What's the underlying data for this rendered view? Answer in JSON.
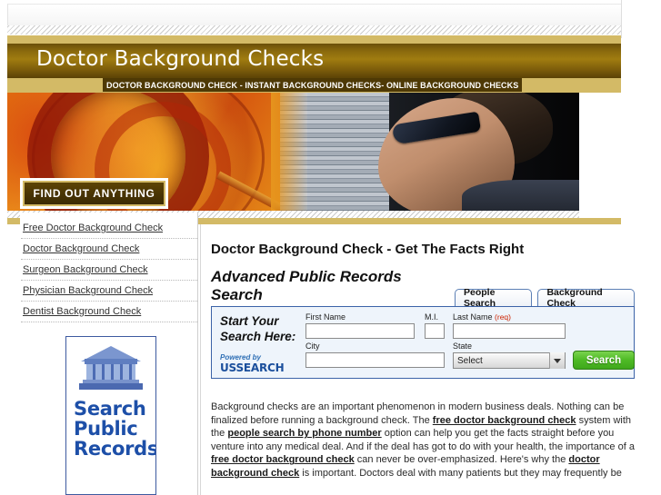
{
  "header": {
    "site_title": "Doctor Background Checks",
    "subtitle": "DOCTOR BACKGROUND CHECK - INSTANT BACKGROUND CHECKS- ONLINE BACKGROUND CHECKS",
    "badge_label": "FIND OUT ANYTHING",
    "gold": "#d3ba66",
    "brown": "#4e3905"
  },
  "sidebar": {
    "items": [
      {
        "label": "Free Doctor Background Check"
      },
      {
        "label": "Doctor Background Check"
      },
      {
        "label": "Surgeon Background Check"
      },
      {
        "label": "Physician Background Check"
      },
      {
        "label": "Dentist Background Check"
      }
    ],
    "banner": {
      "line1": "Search",
      "line2": "Public",
      "line3": "Records",
      "color": "#1d4fa8"
    }
  },
  "main": {
    "page_title": "Doctor Background Check - Get The Facts Right",
    "section_title": "Advanced Public Records Search",
    "tabs": [
      {
        "label": "People Search",
        "active": true
      },
      {
        "label": "Background Check",
        "active": false
      }
    ],
    "form": {
      "start_line1": "Start Your",
      "start_line2": "Search Here:",
      "powered_by": "Powered by",
      "provider": "USSEARCH",
      "first_name_label": "First Name",
      "first_name_value": "",
      "mi_label": "M.I.",
      "mi_value": "",
      "last_name_label": "Last Name",
      "last_name_req": "(req)",
      "last_name_value": "",
      "city_label": "City",
      "city_value": "",
      "state_label": "State",
      "state_value": "Select",
      "search_button": "Search",
      "button_color": "#4fbb26"
    },
    "body_paragraph": {
      "seg1": "Background checks are an important phenomenon in modern business deals. Nothing can be finalized before running a background check. The ",
      "link1": "free doctor background check",
      "seg2": " system with the ",
      "link2": "people search by phone number",
      "seg3": " option can help you get the facts straight before you venture into any medical deal. And if the deal has got to do with your health, the importance of a ",
      "link3": "free doctor background check",
      "seg4": " can never be over-emphasized. Here's why the ",
      "link4": "doctor background check",
      "seg5": " is important. Doctors deal with many patients but they may frequently be"
    }
  }
}
